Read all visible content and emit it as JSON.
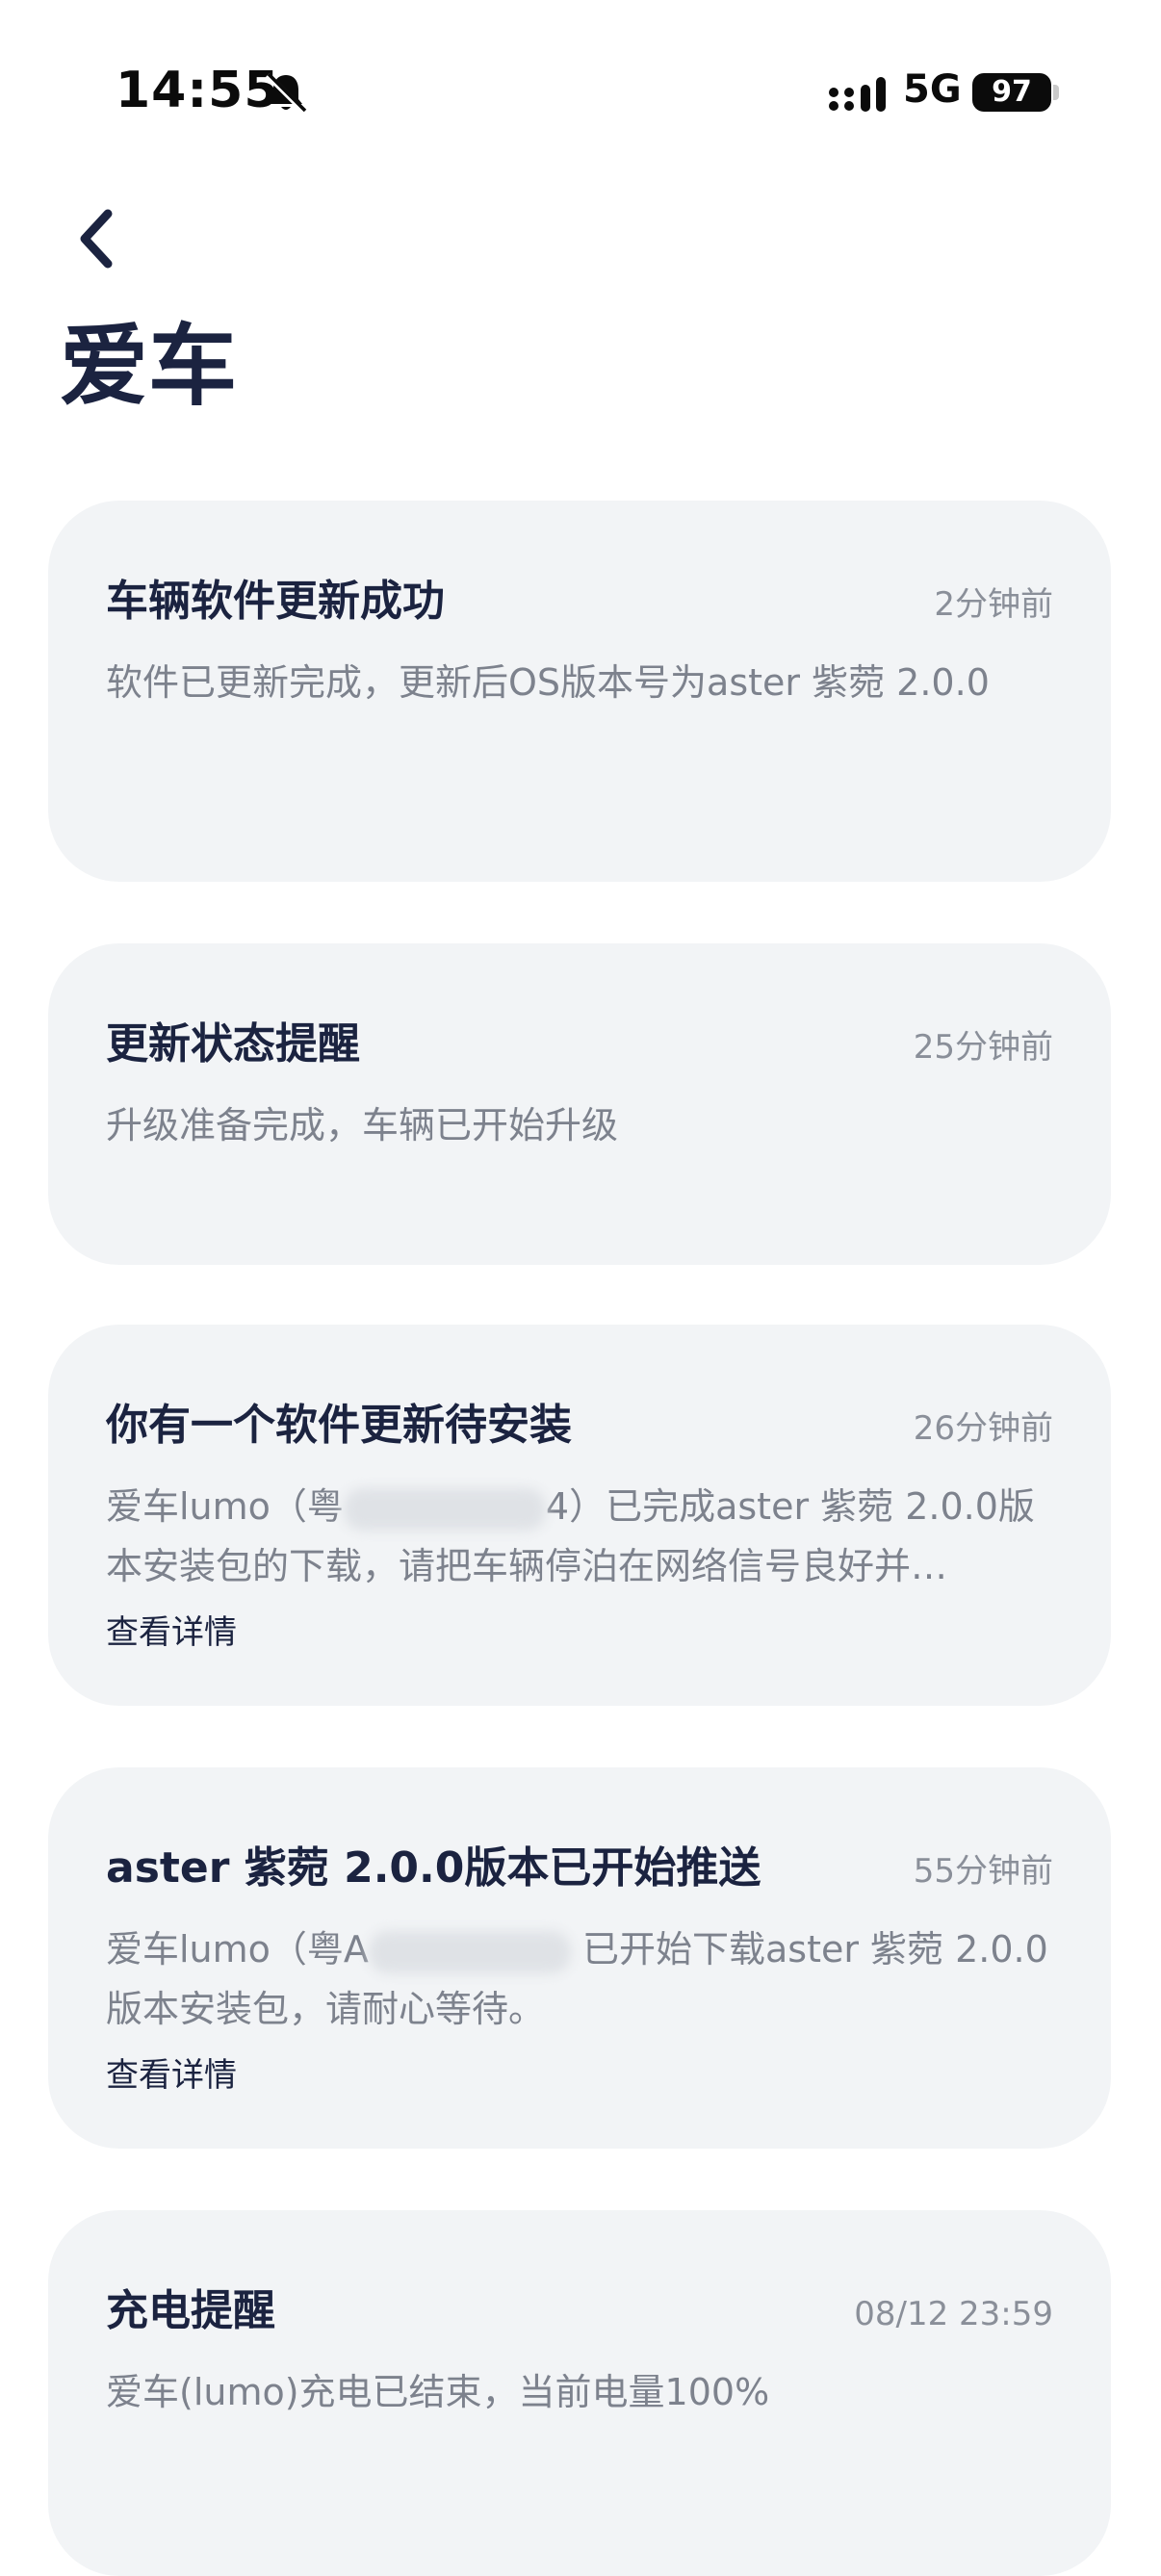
{
  "status_bar": {
    "time": "14:55",
    "network": "5G",
    "battery": "97"
  },
  "header": {
    "title": "爱车"
  },
  "notifications": [
    {
      "title": "车辆软件更新成功",
      "time": "2分钟前",
      "body": "软件已更新完成，更新后OS版本号为aster 紫菀 2.0.0"
    },
    {
      "title": "更新状态提醒",
      "time": "25分钟前",
      "body": "升级准备完成，车辆已开始升级"
    },
    {
      "title": "你有一个软件更新待安装",
      "time": "26分钟前",
      "body_prefix": "爱车lumo（粤",
      "body_suffix": "4）已完成aster 紫菀 2.0.0版本安装包的下载，请把车辆停泊在网络信号良好并…",
      "link": "查看详情"
    },
    {
      "title": "aster 紫菀 2.0.0版本已开始推送",
      "time": "55分钟前",
      "body_prefix": "爱车lumo（粤A",
      "body_suffix": " 已开始下载aster 紫菀 2.0.0版本安装包，请耐心等待。",
      "link": "查看详情"
    },
    {
      "title": "充电提醒",
      "time": "08/12 23:59",
      "body": "爱车(lumo)充电已结束，当前电量100%"
    }
  ]
}
